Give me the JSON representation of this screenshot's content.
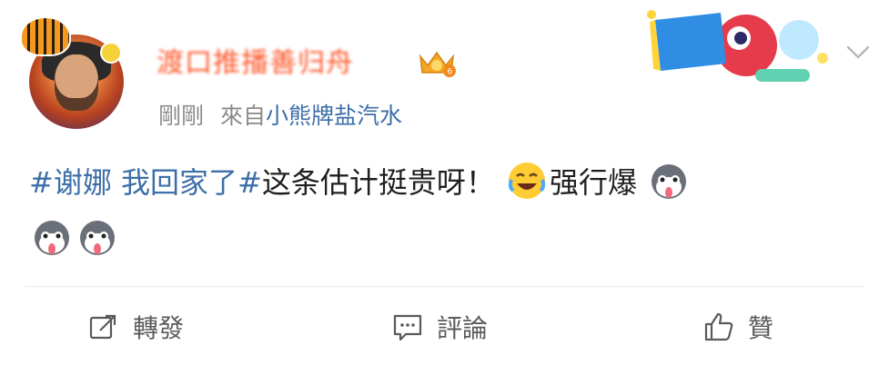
{
  "post": {
    "username": "渡口推播善归舟",
    "time": "剛剛",
    "from_label": "來自",
    "source": "小熊牌盐汽水",
    "text": {
      "topic": "#谢娜 我回家了#",
      "body": "这条估计挺贵呀！",
      "tail": "强行爆"
    }
  },
  "actions": {
    "repost": "轉發",
    "comment": "評論",
    "like": "贊"
  },
  "icons": {
    "vip_badge": "vip-level-6-crown-icon",
    "topic_card": "national-day-mascot-card-icon",
    "chevron": "chevron-down-icon",
    "emoji_laugh_cry": "laughing-crying-emoji-icon",
    "emoji_husky": "husky-dog-emoji-icon"
  },
  "colors": {
    "topic": "#3d6fa8",
    "meta_gray": "#8a8a8a",
    "text": "#1f1f1f"
  }
}
